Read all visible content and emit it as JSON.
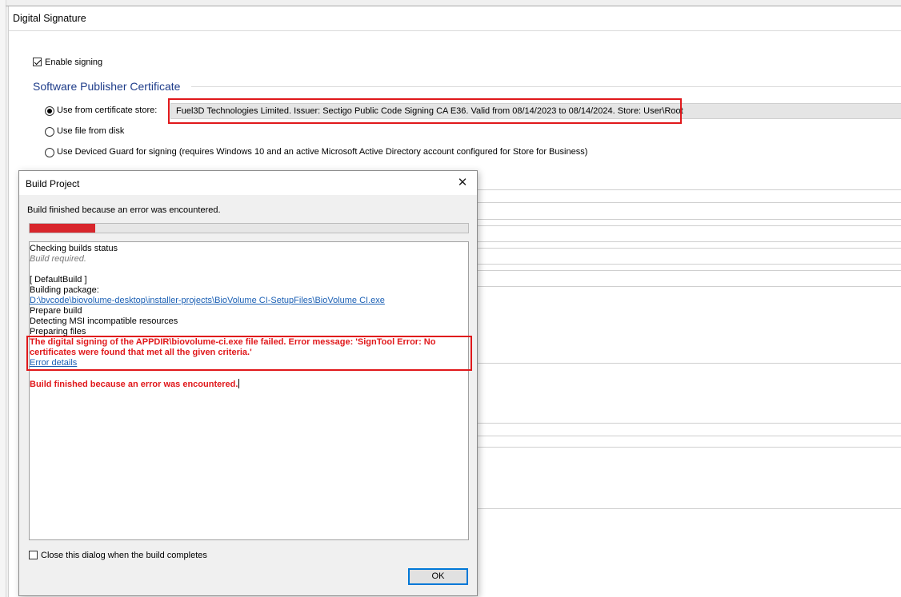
{
  "window": {
    "title": "Digital Signature"
  },
  "signing": {
    "enable_label": "Enable signing",
    "enabled": true
  },
  "certificate": {
    "section_title": "Software Publisher Certificate",
    "options": [
      {
        "label": "Use from certificate store:",
        "selected": true
      },
      {
        "label": "Use file from disk",
        "selected": false
      },
      {
        "label": "Use Deviced Guard for signing (requires Windows 10 and an active Microsoft Active Directory account configured for Store for Business)",
        "selected": false
      }
    ],
    "store_value": "Fuel3D Technologies Limited. Issuer: Sectigo Public Code Signing CA E36. Valid from 08/14/2023 to 08/14/2024. Store: User\\Root"
  },
  "dialog": {
    "title": "Build Project",
    "status": "Build finished because an error was encountered.",
    "progress_fraction": 0.15,
    "log": {
      "checking": "Checking builds status",
      "build_required": "Build required.",
      "default_build": "[ DefaultBuild ]",
      "building_package": "Building package:",
      "package_path": "D:\\bvcode\\biovolume-desktop\\installer-projects\\BioVolume CI-SetupFiles\\BioVolume CI.exe",
      "prepare_build": "Prepare build",
      "detecting": "Detecting MSI incompatible resources",
      "preparing_files": "Preparing files",
      "error_message": "The digital signing of the APPDIR\\biovolume-ci.exe file failed. Error message: 'SignTool Error: No certificates were found that met all the given criteria.'",
      "error_details": "Error details",
      "final": "Build finished because an error was encountered."
    },
    "close_checkbox_label": "Close this dialog when the build completes",
    "close_checkbox_checked": false,
    "ok_label": "OK"
  },
  "colors": {
    "error": "#e0181b",
    "link": "#1a5fb4",
    "section_heading": "#1f3d8a",
    "progress": "#d8262c"
  }
}
